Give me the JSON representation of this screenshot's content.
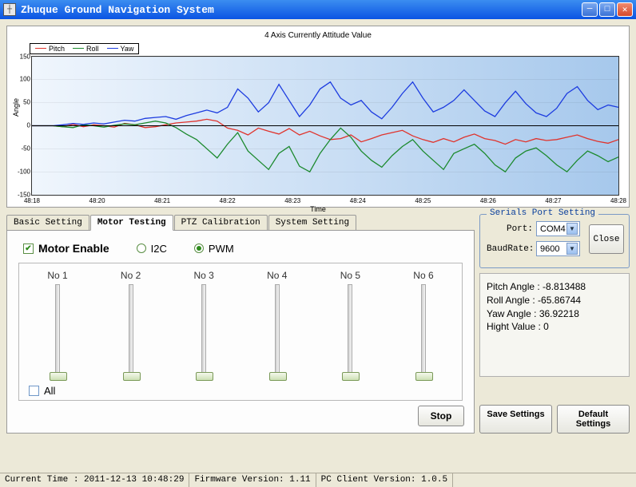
{
  "window": {
    "title": "Zhuque Ground Navigation System"
  },
  "chart_data": {
    "type": "line",
    "title": "4 Axis Currently Attitude Value",
    "xlabel": "Time",
    "ylabel": "Angle",
    "ylim": [
      -150,
      150
    ],
    "yticks": [
      -150,
      -100,
      -50,
      0,
      50,
      100,
      150
    ],
    "xlabels": [
      "48:18",
      "48:20",
      "48:21",
      "48:22",
      "48:23",
      "48:24",
      "48:25",
      "48:26",
      "48:27",
      "48:28"
    ],
    "series": [
      {
        "name": "Pitch",
        "color": "#e0332c",
        "values": [
          0,
          0,
          0,
          -2,
          3,
          -2,
          2,
          0,
          -3,
          5,
          2,
          -4,
          -2,
          2,
          6,
          8,
          10,
          14,
          10,
          -5,
          -10,
          -20,
          -5,
          -12,
          -18,
          -6,
          -20,
          -12,
          -22,
          -30,
          -28,
          -20,
          -35,
          -28,
          -20,
          -15,
          -10,
          -22,
          -30,
          -36,
          -28,
          -35,
          -25,
          -18,
          -28,
          -32,
          -40,
          -30,
          -35,
          -28,
          -32,
          -30,
          -25,
          -20,
          -28,
          -34,
          -38,
          -30
        ]
      },
      {
        "name": "Roll",
        "color": "#1c8a2e",
        "values": [
          0,
          0,
          0,
          -2,
          -4,
          2,
          0,
          -3,
          1,
          4,
          2,
          6,
          10,
          6,
          -4,
          -18,
          -30,
          -50,
          -70,
          -40,
          -15,
          -55,
          -75,
          -95,
          -60,
          -45,
          -88,
          -100,
          -60,
          -30,
          -5,
          -25,
          -55,
          -75,
          -90,
          -65,
          -45,
          -30,
          -55,
          -75,
          -95,
          -60,
          -50,
          -40,
          -60,
          -85,
          -100,
          -70,
          -55,
          -48,
          -65,
          -85,
          -100,
          -75,
          -55,
          -65,
          -78,
          -68
        ]
      },
      {
        "name": "Yaw",
        "color": "#1d3ce0",
        "values": [
          0,
          0,
          0,
          2,
          5,
          3,
          6,
          4,
          8,
          12,
          10,
          16,
          18,
          20,
          14,
          22,
          28,
          34,
          28,
          40,
          80,
          60,
          30,
          50,
          90,
          55,
          20,
          45,
          80,
          95,
          60,
          45,
          55,
          30,
          15,
          40,
          70,
          95,
          60,
          30,
          40,
          55,
          78,
          55,
          32,
          20,
          50,
          75,
          48,
          28,
          20,
          38,
          70,
          85,
          55,
          35,
          45,
          40
        ]
      }
    ]
  },
  "tabs": {
    "items": [
      "Basic Setting",
      "Motor Testing",
      "PTZ Calibration",
      "System Setting"
    ],
    "active": 1
  },
  "motor": {
    "enable_label": "Motor Enable",
    "enable_checked": true,
    "proto_i2c": "I2C",
    "proto_pwm": "PWM",
    "proto_selected": "PWM",
    "sliders": [
      "No 1",
      "No 2",
      "No 3",
      "No 4",
      "No 5",
      "No 6"
    ],
    "all_label": "All",
    "stop_label": "Stop"
  },
  "serial": {
    "title": "Serials Port Setting",
    "port_label": "Port:",
    "port_value": "COM4",
    "baud_label": "BaudRate:",
    "baud_value": "9600",
    "close_label": "Close"
  },
  "readout": {
    "pitch": "Pitch Angle : -8.813488",
    "roll": "Roll Angle : -65.86744",
    "yaw": "Yaw Angle : 36.92218",
    "height": "Hight Value : 0"
  },
  "buttons": {
    "save": "Save Settings",
    "defaults": "Default Settings"
  },
  "status": {
    "time": "Current Time : 2011-12-13 10:48:29",
    "fw": "Firmware Version: 1.11",
    "pc": "PC Client Version: 1.0.5"
  }
}
